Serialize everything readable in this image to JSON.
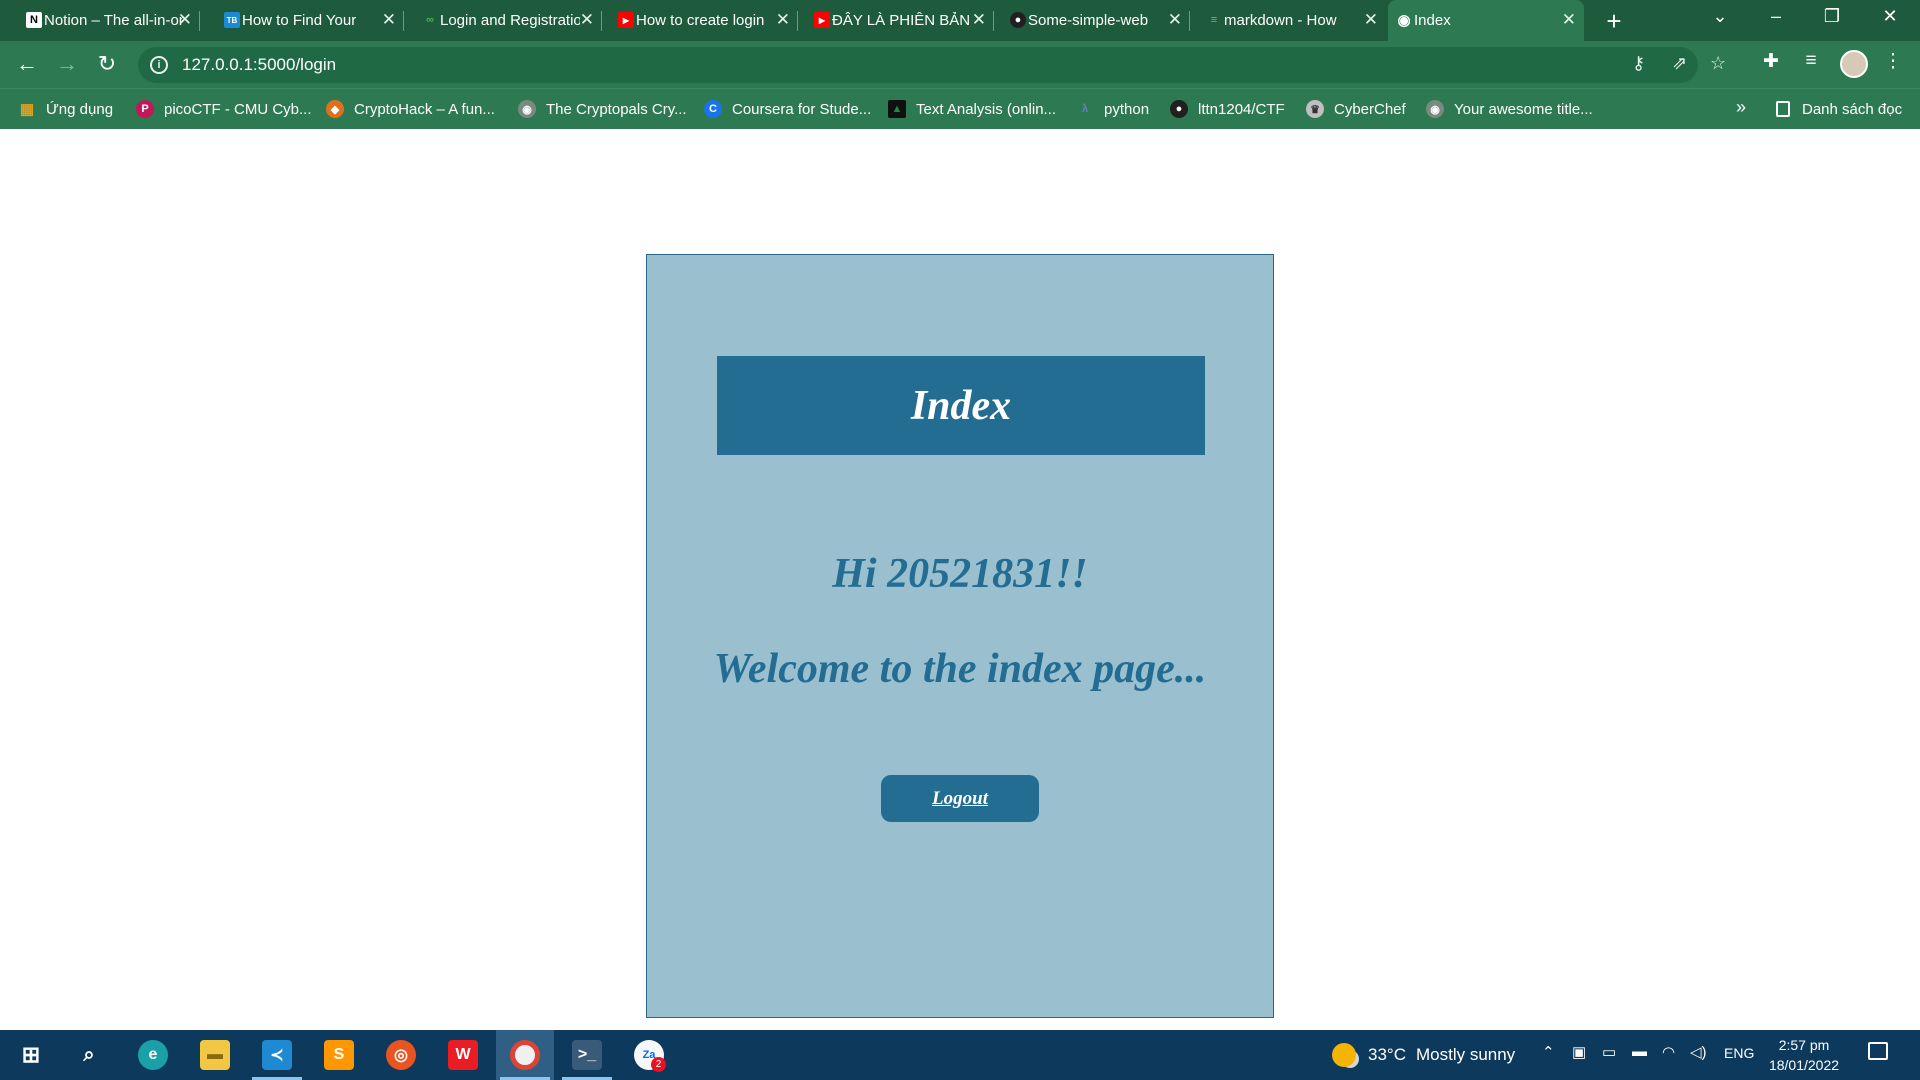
{
  "browser": {
    "tabs": [
      {
        "title": "Notion – The all-in-one workspace",
        "icon": "notion-icon",
        "icon_glyph": "N"
      },
      {
        "title": "How to Find Your",
        "icon": "tb-icon",
        "icon_glyph": "TB"
      },
      {
        "title": "Login and Registration",
        "icon": "link-icon",
        "icon_glyph": "∞"
      },
      {
        "title": "How to create login",
        "icon": "youtube-icon",
        "icon_glyph": "▶"
      },
      {
        "title": "ĐÂY LÀ PHIÊN BẢN",
        "icon": "youtube-icon",
        "icon_glyph": "▶"
      },
      {
        "title": "Some-simple-web",
        "icon": "github-icon",
        "icon_glyph": "●"
      },
      {
        "title": "markdown - How",
        "icon": "stackoverflow-icon",
        "icon_glyph": "≡"
      },
      {
        "title": "Index",
        "icon": "globe-icon",
        "icon_glyph": "◉",
        "active": true
      }
    ],
    "address": {
      "url": "127.0.0.1:5000/login"
    },
    "bookmarks": [
      {
        "label": "Ứng dụng",
        "icon": "apps-grid-icon",
        "color": "#e0a020"
      },
      {
        "label": "picoCTF - CMU Cyb...",
        "icon": "picoctf-icon",
        "color": "#c2185b"
      },
      {
        "label": "CryptoHack – A fun...",
        "icon": "cryptohack-icon",
        "color": "#e07020"
      },
      {
        "label": "The Cryptopals Cry...",
        "icon": "globe-icon",
        "color": "#7a8a80"
      },
      {
        "label": "Coursera for Stude...",
        "icon": "coursera-icon",
        "color": "#1a73e8"
      },
      {
        "label": "Text Analysis (onlin...",
        "icon": "text-analysis-icon",
        "color": "#1e8e3e"
      },
      {
        "label": "python",
        "icon": "python-icon",
        "color": "#3d5a9e"
      },
      {
        "label": "lttn1204/CTF",
        "icon": "github-icon",
        "color": "#202020"
      },
      {
        "label": "CyberChef",
        "icon": "cyberchef-icon",
        "color": "#c0c0c0"
      },
      {
        "label": "Your awesome title...",
        "icon": "globe-icon",
        "color": "#7a8a80"
      }
    ],
    "reading_list": "Danh sách đọc"
  },
  "page": {
    "banner_title": "Index",
    "greeting": "Hi 20521831!!",
    "welcome": "Welcome to the index page...",
    "logout_label": "Logout"
  },
  "taskbar": {
    "apps": [
      "start-icon",
      "search-icon",
      "edge-icon",
      "file-explorer-icon",
      "vscode-icon",
      "sublime-icon",
      "ubuntu-icon",
      "wps-icon",
      "chrome-icon",
      "terminal-icon",
      "zalo-icon"
    ],
    "zalo_badge": "2",
    "weather_temp": "33°C",
    "weather_desc": "Mostly sunny",
    "language": "ENG",
    "time": "2:57 pm",
    "date": "18/01/2022"
  },
  "colors": {
    "chrome_dark": "#1e5a3c",
    "chrome": "#2d7a52",
    "card_bg": "#9ac0d0",
    "accent": "#236c92",
    "taskbar": "#0d3a5c"
  }
}
